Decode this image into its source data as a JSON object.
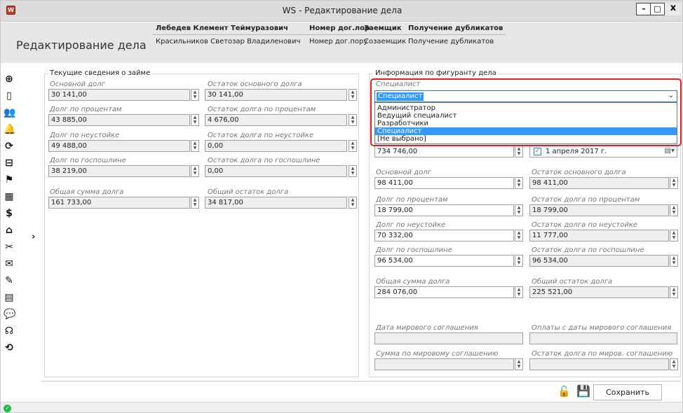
{
  "window": {
    "title": "WS - Редактирование дела",
    "minimize": "–",
    "maximize": "□",
    "close": "x"
  },
  "header": {
    "page_title": "Редактирование дела",
    "row1": {
      "name": "Лебедев Клемент Теймуразович",
      "contract": "Номер дог.лор",
      "role": "Заемщик",
      "action": "Получение дубликатов"
    },
    "row2": {
      "name": "Красильников Светозар Владиленович",
      "contract": "Номер дог.пору",
      "role": "Созаемщик",
      "action": "Получение дубликатов"
    }
  },
  "sidebar": {
    "icons": [
      "doc-plus-icon",
      "doc-icon",
      "users-icon",
      "bell-icon",
      "doc-refresh-icon",
      "doc-bag-icon",
      "person-flag-icon",
      "calendar-icon",
      "dollar-icon",
      "house-search-icon",
      "tools-icon",
      "mail-icon",
      "doc-edit-icon",
      "doc-lines-icon",
      "chat-icon",
      "person-sound-icon",
      "history-icon"
    ],
    "glyphs": [
      "⊕",
      "▯",
      "👥",
      "🔔",
      "⟳",
      "⊟",
      "⚑",
      "▦",
      "$",
      "⌂",
      "✂",
      "✉",
      "✎",
      "▤",
      "💬",
      "☊",
      "⟲"
    ],
    "expand": "›"
  },
  "left": {
    "title": "Текущие сведения о займе",
    "fields": [
      {
        "label": "Основной долг",
        "value": "30 141,00",
        "r_label": "Остаток основного долга",
        "r_value": "30 141,00"
      },
      {
        "label": "Долг по процентам",
        "value": "43 885,00",
        "r_label": "Остаток долга по процентам",
        "r_value": "4 676,00"
      },
      {
        "label": "Долг по неустойке",
        "value": "49 488,00",
        "r_label": "Остаток долга по неустойке",
        "r_value": "0,00"
      },
      {
        "label": "Долг по госпошлине",
        "value": "38 219,00",
        "r_label": "Остаток долга по госпошлине",
        "r_value": "0,00"
      },
      {
        "label": "Общая сумма долга",
        "value": "161 733,00",
        "r_label": "Общий остаток долга",
        "r_value": "34 817,00"
      }
    ]
  },
  "right": {
    "title": "Информация по фигуранту дела",
    "specialist_label": "Специалист",
    "specialist_value": "Специалист",
    "options": [
      "Администратор",
      "Ведущий специалист",
      "Разработчики",
      "Специалист",
      "[Не выбрано]"
    ],
    "selected_index": 3,
    "amount_value": "734 746,00",
    "date_checked": "✓",
    "date_text": "1  апреля  2017 г.",
    "fields": [
      {
        "label": "Основной долг",
        "value": "98 411,00",
        "r_label": "Остаток основного долга",
        "r_value": "98 411,00"
      },
      {
        "label": "Долг по процентам",
        "value": "18 799,00",
        "r_label": "Остаток долга по процентам",
        "r_value": "18 799,00"
      },
      {
        "label": "Долг по неустойке",
        "value": "70 332,00",
        "r_label": "Остаток долга по неустойке",
        "r_value": "11 777,00"
      },
      {
        "label": "Долг по госпошлине",
        "value": "96 534,00",
        "r_label": "Остаток долга по госпошлине",
        "r_value": "96 534,00"
      },
      {
        "label": "Общая сумма долга",
        "value": "284 076,00",
        "r_label": "Общий остаток долга",
        "r_value": "225 521,00"
      }
    ],
    "settlement": {
      "date_label": "Дата мирового соглашения",
      "pay_label": "Оплаты с даты мирового соглашения",
      "sum_label": "Сумма по мировому соглашению",
      "rest_label": "Остаток долга по миров. соглашению"
    }
  },
  "footer": {
    "save_label": "Сохранить"
  }
}
